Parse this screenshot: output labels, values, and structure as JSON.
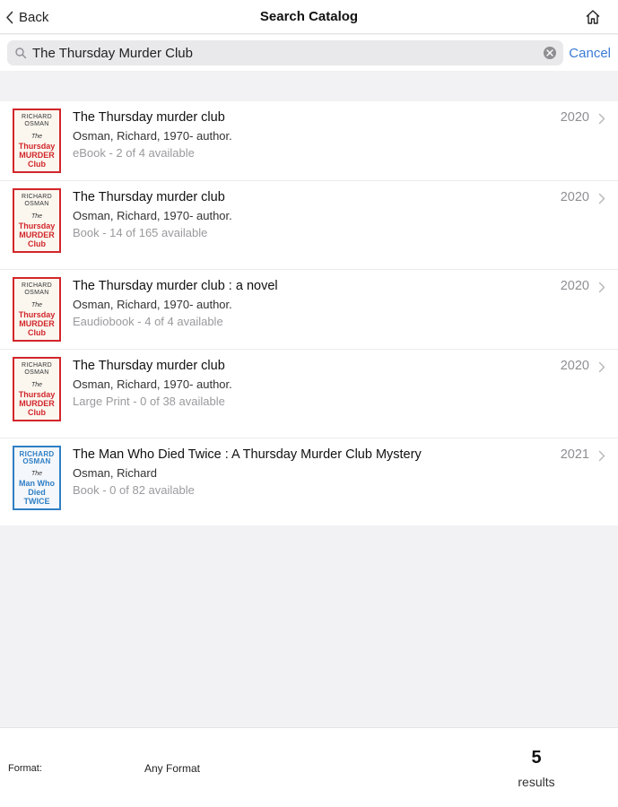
{
  "nav": {
    "back_label": "Back",
    "title": "Search Catalog",
    "home_icon": "home-icon"
  },
  "search": {
    "value": "The Thursday Murder Club",
    "cancel_label": "Cancel"
  },
  "results": [
    {
      "title": "The Thursday murder club",
      "author": "Osman, Richard, 1970- author.",
      "format": "eBook - 2 of 4 available",
      "year": "2020",
      "cover": {
        "author": "RICHARD OSMAN",
        "the": "The",
        "main": "Thursday MURDER Club"
      }
    },
    {
      "title": "The Thursday murder club",
      "author": "Osman, Richard, 1970- author.",
      "format": "Book - 14 of 165 available",
      "year": "2020",
      "cover": {
        "author": "RICHARD OSMAN",
        "the": "The",
        "main": "Thursday MURDER Club"
      }
    },
    {
      "title": "The Thursday murder club : a novel",
      "author": "Osman, Richard, 1970- author.",
      "format": "Eaudiobook - 4 of 4 available",
      "year": "2020",
      "cover": {
        "author": "RICHARD OSMAN",
        "the": "The",
        "main": "Thursday MURDER Club"
      }
    },
    {
      "title": "The Thursday murder club",
      "author": "Osman, Richard, 1970- author.",
      "format": "Large Print - 0 of 38 available",
      "year": "2020",
      "cover": {
        "author": "RICHARD OSMAN",
        "the": "The",
        "main": "Thursday MURDER Club"
      }
    },
    {
      "title": "The Man Who Died Twice : A Thursday Murder Club Mystery",
      "author": "Osman, Richard",
      "format": "Book - 0 of 82 available",
      "year": "2021",
      "cover": {
        "author": "RICHARD OSMAN",
        "the": "The",
        "main": "Man Who Died TWICE"
      }
    }
  ],
  "footer": {
    "format_label": "Format:",
    "format_value": "Any Format",
    "count": "5",
    "count_label": "results"
  },
  "colors": {
    "accent": "#3a7bd5",
    "cover_red": "#d2262b",
    "cover_blue": "#2f7fc4",
    "background": "#f2f2f4"
  }
}
